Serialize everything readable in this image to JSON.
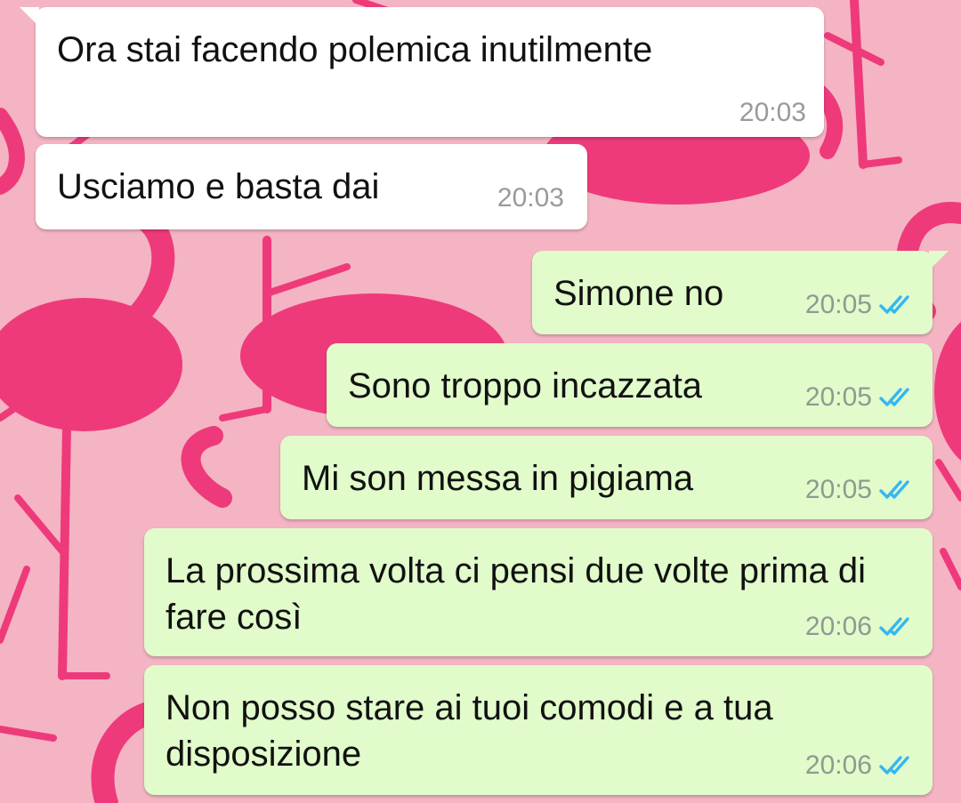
{
  "theme": {
    "wallpaper_bg": "#f4b4c3",
    "flamingo_color": "#ee3a7a",
    "incoming_bubble": "#ffffff",
    "outgoing_bubble": "#e1fbcb",
    "read_tick_color": "#34b7f1"
  },
  "messages": [
    {
      "direction": "incoming",
      "text": "Ora stai facendo polemica inutilmente",
      "time": "20:03"
    },
    {
      "direction": "incoming",
      "text": "Usciamo e basta dai",
      "time": "20:03"
    },
    {
      "direction": "outgoing",
      "text": "Simone no",
      "time": "20:05",
      "status": "read-double-check-icon"
    },
    {
      "direction": "outgoing",
      "text": "Sono troppo incazzata",
      "time": "20:05",
      "status": "read-double-check-icon"
    },
    {
      "direction": "outgoing",
      "text": "Mi son messa in pigiama",
      "time": "20:05",
      "status": "read-double-check-icon"
    },
    {
      "direction": "outgoing",
      "text": "La prossima volta ci pensi due volte prima di fare così",
      "time": "20:06",
      "status": "read-double-check-icon"
    },
    {
      "direction": "outgoing",
      "text": "Non posso stare ai tuoi comodi e a tua disposizione",
      "time": "20:06",
      "status": "read-double-check-icon"
    }
  ]
}
